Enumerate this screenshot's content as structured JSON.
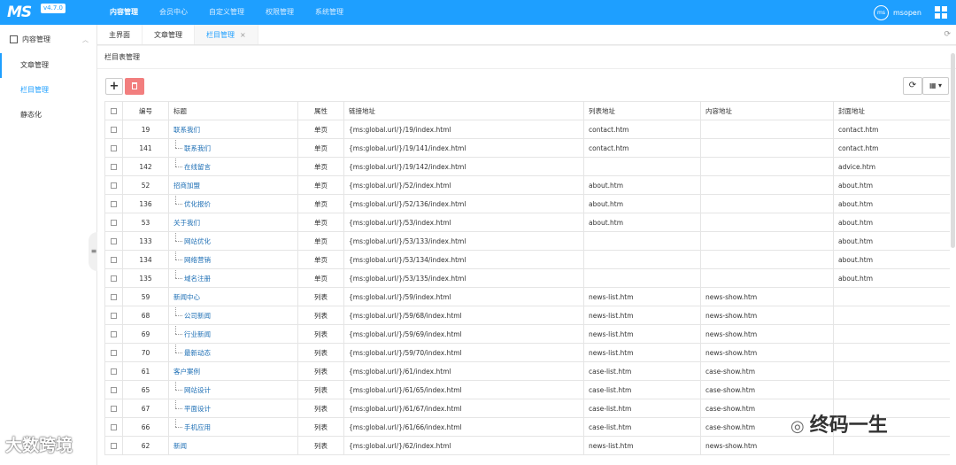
{
  "app": {
    "logo": "MS",
    "version": "v4.7.0"
  },
  "topnav": [
    "内容管理",
    "会员中心",
    "自定义管理",
    "权限管理",
    "系统管理"
  ],
  "user": {
    "avatar": "ms",
    "name": "msopen"
  },
  "sidebar": {
    "group": "内容管理",
    "items": [
      "文章管理",
      "栏目管理",
      "静态化"
    ]
  },
  "tabs": [
    "主界面",
    "文章管理",
    "栏目管理"
  ],
  "tab_close": "×",
  "panel_title": "栏目表管理",
  "toolbar": {
    "add": "+",
    "refresh": "⟳",
    "columns": "▦ ▾"
  },
  "table": {
    "headers": [
      "编号",
      "标题",
      "属性",
      "链接地址",
      "列表地址",
      "内容地址",
      "封面地址"
    ],
    "rows": [
      {
        "id": "19",
        "title": "联系我们",
        "level": 1,
        "attr": "单页",
        "url": "{ms:global.url/}/19/index.html",
        "list": "contact.htm",
        "content": "",
        "cover": "contact.htm"
      },
      {
        "id": "141",
        "title": "联系我们",
        "level": 2,
        "attr": "单页",
        "url": "{ms:global.url/}/19/141/index.html",
        "list": "contact.htm",
        "content": "",
        "cover": "contact.htm"
      },
      {
        "id": "142",
        "title": "在线留言",
        "level": 2,
        "attr": "单页",
        "url": "{ms:global.url/}/19/142/index.html",
        "list": "",
        "content": "",
        "cover": "advice.htm"
      },
      {
        "id": "52",
        "title": "招商加盟",
        "level": 1,
        "attr": "单页",
        "url": "{ms:global.url/}/52/index.html",
        "list": "about.htm",
        "content": "",
        "cover": "about.htm"
      },
      {
        "id": "136",
        "title": "优化报价",
        "level": 2,
        "attr": "单页",
        "url": "{ms:global.url/}/52/136/index.html",
        "list": "about.htm",
        "content": "",
        "cover": "about.htm"
      },
      {
        "id": "53",
        "title": "关于我们",
        "level": 1,
        "attr": "单页",
        "url": "{ms:global.url/}/53/index.html",
        "list": "about.htm",
        "content": "",
        "cover": "about.htm"
      },
      {
        "id": "133",
        "title": "网站优化",
        "level": 2,
        "attr": "单页",
        "url": "{ms:global.url/}/53/133/index.html",
        "list": "",
        "content": "",
        "cover": "about.htm"
      },
      {
        "id": "134",
        "title": "网络营销",
        "level": 2,
        "attr": "单页",
        "url": "{ms:global.url/}/53/134/index.html",
        "list": "",
        "content": "",
        "cover": "about.htm"
      },
      {
        "id": "135",
        "title": "域名注册",
        "level": 2,
        "attr": "单页",
        "url": "{ms:global.url/}/53/135/index.html",
        "list": "",
        "content": "",
        "cover": "about.htm"
      },
      {
        "id": "59",
        "title": "新闻中心",
        "level": 1,
        "attr": "列表",
        "url": "{ms:global.url/}/59/index.html",
        "list": "news-list.htm",
        "content": "news-show.htm",
        "cover": ""
      },
      {
        "id": "68",
        "title": "公司新闻",
        "level": 2,
        "attr": "列表",
        "url": "{ms:global.url/}/59/68/index.html",
        "list": "news-list.htm",
        "content": "news-show.htm",
        "cover": ""
      },
      {
        "id": "69",
        "title": "行业新闻",
        "level": 2,
        "attr": "列表",
        "url": "{ms:global.url/}/59/69/index.html",
        "list": "news-list.htm",
        "content": "news-show.htm",
        "cover": ""
      },
      {
        "id": "70",
        "title": "最新动态",
        "level": 2,
        "attr": "列表",
        "url": "{ms:global.url/}/59/70/index.html",
        "list": "news-list.htm",
        "content": "news-show.htm",
        "cover": ""
      },
      {
        "id": "61",
        "title": "客户案例",
        "level": 1,
        "attr": "列表",
        "url": "{ms:global.url/}/61/index.html",
        "list": "case-list.htm",
        "content": "case-show.htm",
        "cover": ""
      },
      {
        "id": "65",
        "title": "网站设计",
        "level": 2,
        "attr": "列表",
        "url": "{ms:global.url/}/61/65/index.html",
        "list": "case-list.htm",
        "content": "case-show.htm",
        "cover": ""
      },
      {
        "id": "67",
        "title": "平面设计",
        "level": 2,
        "attr": "列表",
        "url": "{ms:global.url/}/61/67/index.html",
        "list": "case-list.htm",
        "content": "case-show.htm",
        "cover": ""
      },
      {
        "id": "66",
        "title": "手机应用",
        "level": 2,
        "attr": "列表",
        "url": "{ms:global.url/}/61/66/index.html",
        "list": "case-list.htm",
        "content": "case-show.htm",
        "cover": ""
      },
      {
        "id": "62",
        "title": "新闻",
        "level": 1,
        "attr": "列表",
        "url": "{ms:global.url/}/62/index.html",
        "list": "news-list.htm",
        "content": "news-show.htm",
        "cover": ""
      }
    ]
  },
  "watermarks": {
    "left": "大数跨境",
    "right": "终码一生"
  },
  "colors": {
    "topbar": "#1e9fff",
    "accent": "#1e9fff",
    "danger": "#f27e7e",
    "link": "#1e6fb5"
  }
}
